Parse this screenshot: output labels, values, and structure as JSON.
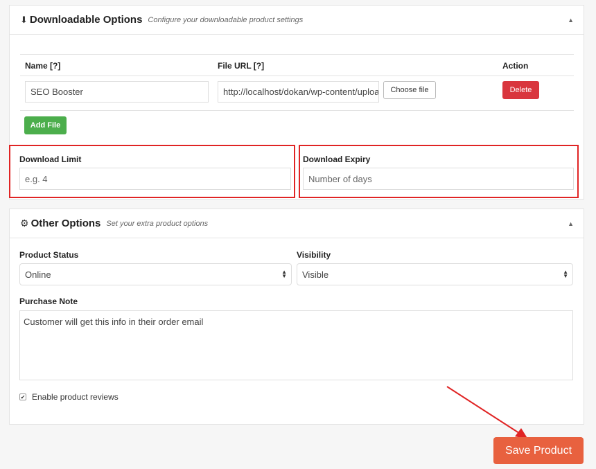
{
  "downloadable": {
    "title": "Downloadable Options",
    "subtitle": "Configure your downloadable product settings",
    "columns": {
      "name": "Name [?]",
      "file_url": "File URL [?]",
      "action": "Action"
    },
    "row": {
      "name": "SEO Booster",
      "file_url": "http://localhost/dokan/wp-content/uploads",
      "choose_label": "Choose file",
      "delete_label": "Delete"
    },
    "add_file_label": "Add File",
    "download_limit": {
      "label": "Download Limit",
      "placeholder": "e.g. 4"
    },
    "download_expiry": {
      "label": "Download Expiry",
      "placeholder": "Number of days"
    }
  },
  "other": {
    "title": "Other Options",
    "subtitle": "Set your extra product options",
    "product_status": {
      "label": "Product Status",
      "value": "Online"
    },
    "visibility": {
      "label": "Visibility",
      "value": "Visible"
    },
    "purchase_note": {
      "label": "Purchase Note",
      "value": "Customer will get this info in their order email"
    },
    "enable_reviews": {
      "label": "Enable product reviews",
      "checked": true
    }
  },
  "save_label": "Save Product",
  "colors": {
    "save": "#e8613f",
    "delete": "#d9363e",
    "add": "#4cae4c",
    "highlight": "#e02424"
  }
}
